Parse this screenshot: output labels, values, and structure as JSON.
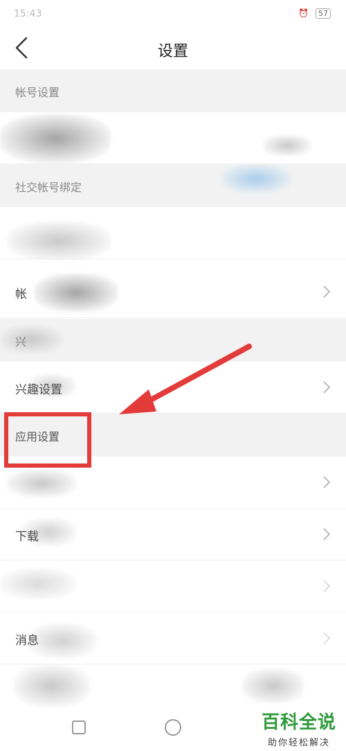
{
  "status_bar": {
    "time": "15:43",
    "battery": "57"
  },
  "header": {
    "title": "设置"
  },
  "rows": [
    {
      "type": "section",
      "label": "帐号设置"
    },
    {
      "type": "item",
      "label": "",
      "chevron": false
    },
    {
      "type": "section",
      "label": "社交帐号绑定"
    },
    {
      "type": "item",
      "label": "",
      "chevron": false
    },
    {
      "type": "item",
      "label": "帐",
      "chevron": true
    },
    {
      "type": "section",
      "label": "兴"
    },
    {
      "type": "item",
      "label": "兴趣设置",
      "chevron": true
    },
    {
      "type": "section",
      "label": "应用设置"
    },
    {
      "type": "item",
      "label": "",
      "chevron": true
    },
    {
      "type": "item",
      "label": "下载",
      "chevron": true
    },
    {
      "type": "item",
      "label": "",
      "chevron": true
    },
    {
      "type": "item",
      "label": "消息",
      "chevron": true
    }
  ],
  "annotation": {
    "color": "#e33a3a"
  },
  "watermark": {
    "title": "百科全说",
    "subtitle": "助你轻松解决"
  }
}
